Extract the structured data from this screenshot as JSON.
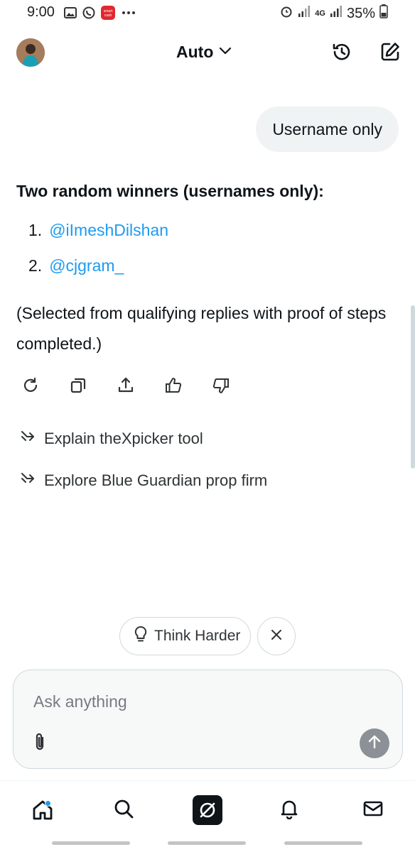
{
  "status_bar": {
    "time": "9:00",
    "left_icons": [
      "gallery-icon",
      "whatsapp-icon",
      "smart-cash-icon",
      "more-icon"
    ],
    "battery": "35%",
    "network": "4G"
  },
  "header": {
    "model_label": "Auto",
    "icons": [
      "history-icon",
      "new-chat-icon"
    ]
  },
  "conversation": {
    "user_message": "Username only",
    "answer_title": "Two random winners (usernames only):",
    "winners": [
      {
        "num": "1.",
        "handle": "@iImeshDilshan"
      },
      {
        "num": "2.",
        "handle": "@cjgram_"
      }
    ],
    "note": "(Selected from qualifying replies with proof of steps completed.)",
    "actions": [
      "regenerate-icon",
      "copy-icon",
      "share-icon",
      "thumbs-up-icon",
      "thumbs-down-icon"
    ],
    "suggestions": [
      "Explain theXpicker tool",
      "Explore Blue Guardian prop firm"
    ]
  },
  "think_chip": {
    "label": "Think Harder"
  },
  "composer": {
    "placeholder": "Ask anything"
  },
  "bottom_nav": [
    "home-icon",
    "search-icon",
    "grok-icon",
    "notifications-icon",
    "messages-icon"
  ],
  "colors": {
    "link": "#1d9bf0",
    "text": "#0f1419",
    "bubble": "#eff3f4",
    "send_button": "#8b9196"
  }
}
